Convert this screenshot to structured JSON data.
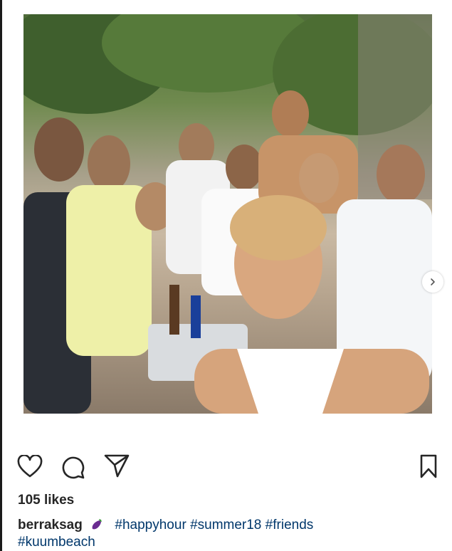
{
  "post": {
    "photo_alt": "",
    "likes_text": "105 likes",
    "username": "berraksag",
    "caption_emoji": "eggplant-emoji",
    "hashtags": [
      "#happyhour",
      "#summer18",
      "#friends",
      "#kuumbeach"
    ]
  },
  "actions": {
    "like": "heart-icon",
    "comment": "comment-icon",
    "share": "paper-plane-icon",
    "save": "bookmark-icon",
    "carousel_next": "chevron-right-icon"
  },
  "colors": {
    "text": "#262626",
    "hashtag": "#00376b",
    "background": "#ffffff"
  }
}
